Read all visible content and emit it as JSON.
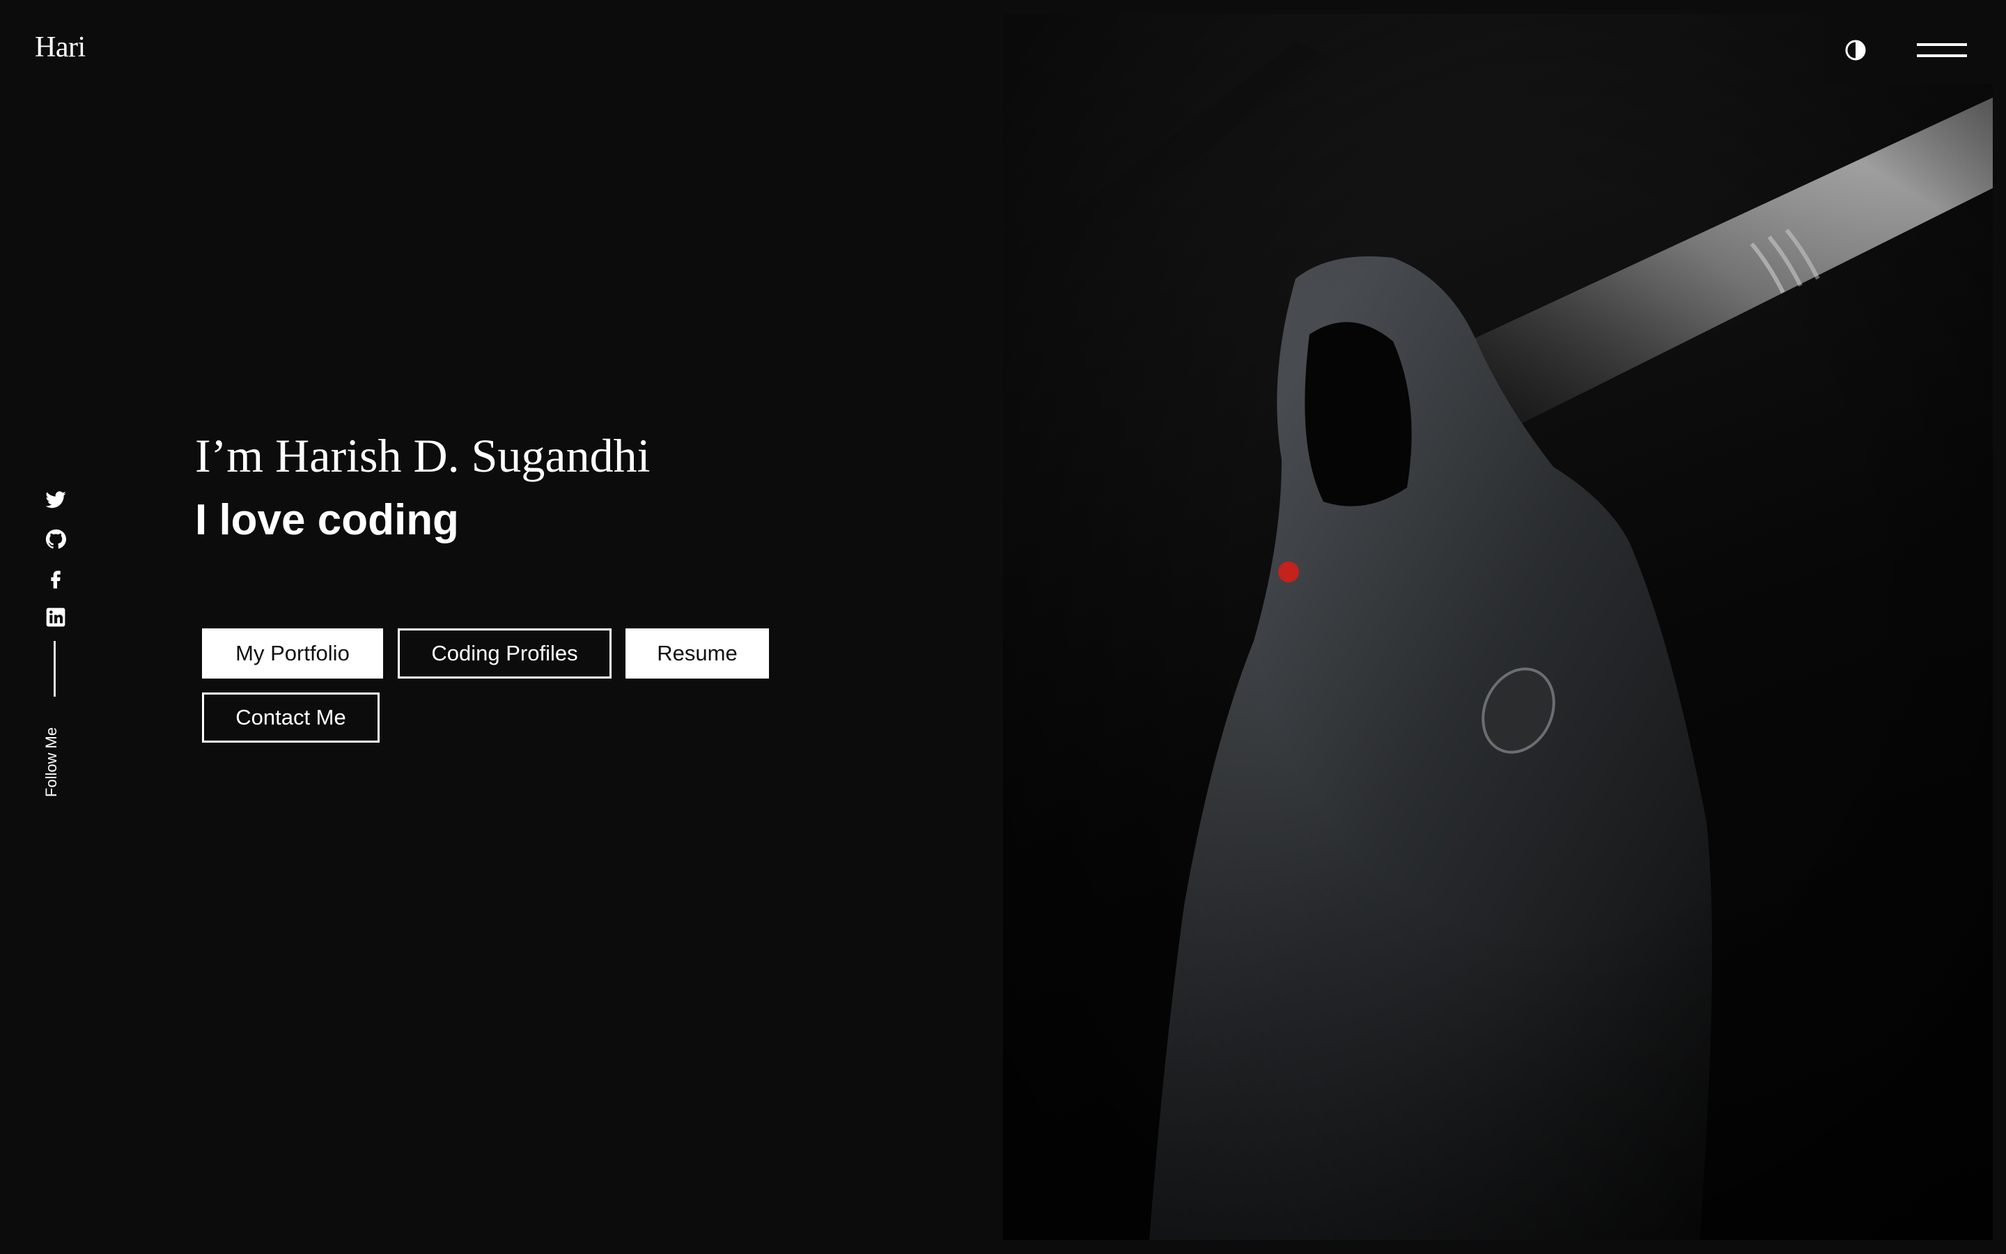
{
  "header": {
    "logo": "Hari",
    "theme_toggle_icon": "contrast-icon",
    "menu_icon": "hamburger-menu-icon"
  },
  "social": {
    "links": [
      {
        "name": "twitter",
        "icon": "twitter-icon"
      },
      {
        "name": "github",
        "icon": "github-icon"
      },
      {
        "name": "facebook",
        "icon": "facebook-icon"
      },
      {
        "name": "linkedin",
        "icon": "linkedin-icon"
      }
    ],
    "follow_label": "Follow Me"
  },
  "hero": {
    "headline": "I’m Harish D. Sugandhi",
    "tagline": "I love coding",
    "buttons": {
      "portfolio": "My Portfolio",
      "profiles": "Coding Profiles",
      "resume": "Resume",
      "contact": "Contact Me"
    },
    "image_alt": "hooded-figure-photo"
  },
  "colors": {
    "background": "#0c0c0c",
    "text": "#ffffff",
    "cursor_dot": "#c4221c"
  }
}
